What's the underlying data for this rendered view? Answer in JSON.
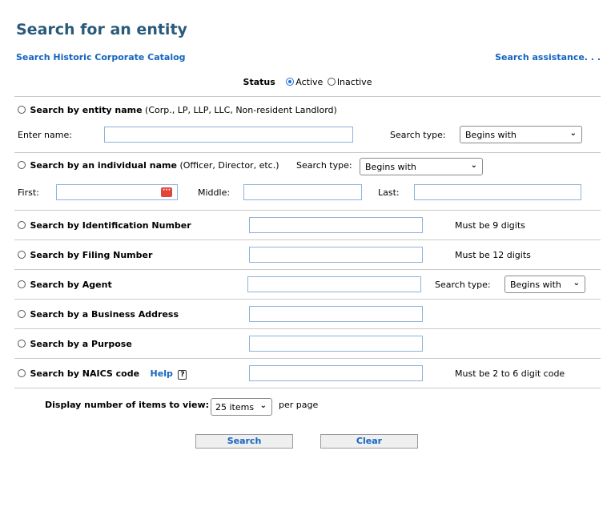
{
  "header": {
    "title": "Search for an entity",
    "historic_link": "Search Historic Corporate Catalog",
    "assistance_link": "Search assistance. . ."
  },
  "status": {
    "label": "Status",
    "options": [
      "Active",
      "Inactive"
    ],
    "selected": "Active"
  },
  "entity_name": {
    "title": "Search by entity name",
    "note": "(Corp., LP, LLP, LLC, Non-resident Landlord)",
    "enter_label": "Enter name:",
    "search_type_label": "Search type:",
    "search_type_value": "Begins with"
  },
  "individual": {
    "title": "Search by an individual name",
    "note": "(Officer, Director, etc.)",
    "search_type_label": "Search type:",
    "search_type_value": "Begins with",
    "first_label": "First:",
    "middle_label": "Middle:",
    "last_label": "Last:"
  },
  "id_number": {
    "title": "Search by Identification Number",
    "hint": "Must be 9 digits"
  },
  "filing_number": {
    "title": "Search by Filing Number",
    "hint": "Must be 12 digits"
  },
  "agent": {
    "title": "Search by Agent",
    "search_type_label": "Search type:",
    "search_type_value": "Begins with"
  },
  "business_address": {
    "title": "Search by a Business Address"
  },
  "purpose": {
    "title": "Search by a Purpose"
  },
  "naics": {
    "title": "Search by NAICS code",
    "help": "Help",
    "help_icon_glyph": "?",
    "hint": "Must be 2 to 6 digit code"
  },
  "display": {
    "label": "Display number of items to view:",
    "value": "25 items",
    "suffix": "per page"
  },
  "buttons": {
    "search": "Search",
    "clear": "Clear"
  },
  "colors": {
    "title": "#2a5a7a",
    "link": "#1565c0",
    "input_border": "#8fb3d9"
  }
}
